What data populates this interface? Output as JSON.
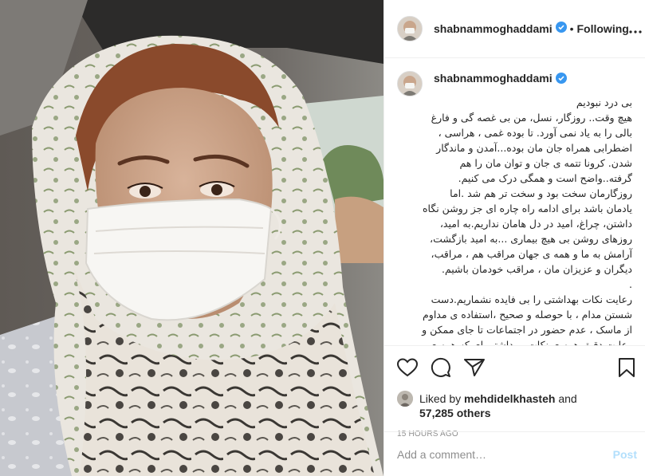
{
  "post": {
    "username": "shabnammoghaddami",
    "separator": "•",
    "follow_status": "Following",
    "more": "•••",
    "caption": "بی درد نبودیم\nهیچ وقت.. روزگار، نسل، من بی غصه گی و فارغ بالی را به یاد نمی آورد. تا بوده غمی ، هراسی ، اضطرابی همراه جان مان بوده...آمدن و ماندگار شدن. کرونا تتمه ی جان و توان مان را هم گرفته..واضح است و همگی درک می کنیم. روزگارمان سخت بود و سخت تر هم شد .اما یادمان باشد برای ادامه راه چاره ای جز روشن نگاه داشتن، چراغ، امید در دل هامان نداریم.به امید، روزهای روشن بی هیچ بیماری ...به امید بازگشت، آرامش به ما و همه ی جهان مراقب هم ، مراقب، دیگران و عزیزان مان ، مراقب خودمان باشیم.\n.\nرعایت نکات بهداشتی را بی فایده نشماریم.دست شستن مدام ، با حوصله و صحیح ،استفاده ی مداوم از ماسک ، عدم حضور در اجتماعات تا جای ممکن و رعایت دقیق همه ی نکات، بهداشتی ای که همه ی ما هر روز چندین بار می خوانیم و می شنویم. می تواند",
    "likes_prefix": "Liked by",
    "liked_by": "mehdidelkhasteh",
    "likes_and": "and",
    "likes_count": "57,285 others",
    "timestamp": "15 HOURS AGO",
    "comment_placeholder": "Add a comment…",
    "post_button": "Post"
  },
  "colors": {
    "verified": "#3897f0",
    "post_button": "#b2dffc",
    "muted": "#8e8e8e"
  },
  "icons": [
    "heart-icon",
    "comment-icon",
    "share-icon",
    "bookmark-icon",
    "verified-icon",
    "more-icon"
  ]
}
